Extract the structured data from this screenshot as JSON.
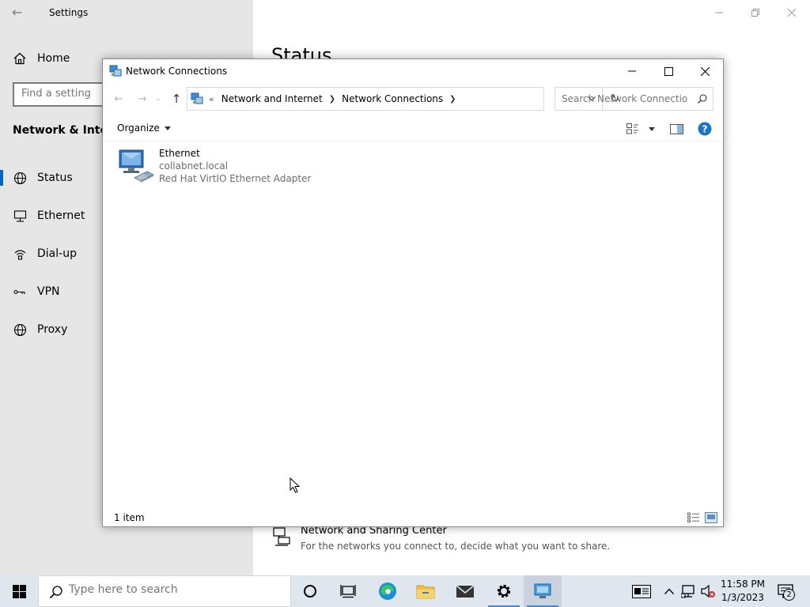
{
  "settings": {
    "app_title": "Settings",
    "home_label": "Home",
    "search_placeholder": "Find a setting",
    "section_title": "Network & Internet",
    "nav_items": [
      {
        "label": "Status",
        "icon": "globe-icon"
      },
      {
        "label": "Ethernet",
        "icon": "ethernet-icon"
      },
      {
        "label": "Dial-up",
        "icon": "dialup-icon"
      },
      {
        "label": "VPN",
        "icon": "vpn-icon"
      },
      {
        "label": "Proxy",
        "icon": "globe-icon"
      }
    ],
    "page_title": "Status",
    "sharing_center": {
      "title": "Network and Sharing Center",
      "description": "For the networks you connect to, decide what you want to share."
    }
  },
  "explorer": {
    "title": "Network Connections",
    "breadcrumb": [
      "Network and Internet",
      "Network Connections"
    ],
    "search_placeholder": "Search Network Connections",
    "organize_label": "Organize",
    "items": [
      {
        "name": "Ethernet",
        "network": "collabnet.local",
        "adapter": "Red Hat VirtIO Ethernet Adapter"
      }
    ],
    "status_text": "1 item"
  },
  "taskbar": {
    "search_placeholder": "Type here to search",
    "clock_time": "11:58 PM",
    "clock_date": "1/3/2023",
    "notification_count": "2"
  },
  "colors": {
    "accent": "#0067c0",
    "sidebar_bg": "#e6e6e6",
    "taskbar_bg": "#dfe6ee",
    "help_blue": "#1e73be"
  }
}
